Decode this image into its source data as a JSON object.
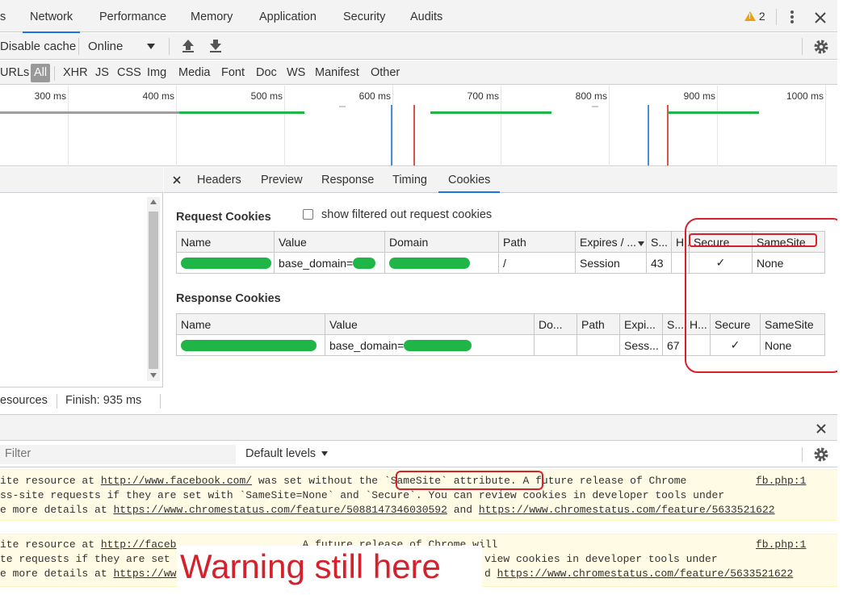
{
  "tabs": {
    "items": [
      "s",
      "Network",
      "Performance",
      "Memory",
      "Application",
      "Security",
      "Audits"
    ],
    "active": "Network",
    "warning_count": "2"
  },
  "toolbar": {
    "disable_cache": "Disable cache",
    "throttle": "Online"
  },
  "filters": {
    "urls": "URLs",
    "items": [
      "All",
      "XHR",
      "JS",
      "CSS",
      "Img",
      "Media",
      "Font",
      "Doc",
      "WS",
      "Manifest",
      "Other"
    ]
  },
  "timeline": {
    "ticks": [
      "300 ms",
      "400 ms",
      "500 ms",
      "600 ms",
      "700 ms",
      "800 ms",
      "900 ms",
      "1000 ms"
    ],
    "colors": {
      "green": "#1fb547",
      "grey": "#9e9e9e",
      "blue": "#4c8ed9",
      "red": "#d9534f"
    }
  },
  "left_panel": {
    "status_resources": "esources",
    "status_finish": "Finish: 935 ms"
  },
  "detail_tabs": {
    "items": [
      "Headers",
      "Preview",
      "Response",
      "Timing",
      "Cookies"
    ],
    "active": "Cookies"
  },
  "request_cookies": {
    "title": "Request Cookies",
    "filter_label": "show filtered out request cookies",
    "headers": [
      "Name",
      "Value",
      "Domain",
      "Path",
      "Expires / ...",
      "S...",
      "H...",
      "Secure",
      "SameSite"
    ],
    "row": {
      "value": "base_domain=",
      "path": "/",
      "expires": "Session",
      "size": "43",
      "secure": "✓",
      "samesite": "None"
    }
  },
  "response_cookies": {
    "title": "Response Cookies",
    "headers": [
      "Name",
      "Value",
      "Do...",
      "Path",
      "Expi...",
      "S...",
      "H...",
      "Secure",
      "SameSite"
    ],
    "row": {
      "value": "base_domain=",
      "expires": "Sess...",
      "size": "67",
      "secure": "✓",
      "samesite": "None"
    }
  },
  "console": {
    "filter_placeholder": "Filter",
    "levels": "Default levels",
    "warning1": {
      "l1a": "ite resource at ",
      "l1link": "http://www.facebook.com/",
      "l1b": " was set without the ",
      "l1c": "`SameSite` attribute.",
      "l1d": " A future release of Chrome",
      "l2": "ss-site requests if they are set with `SameSite=None` and `Secure`. You can review cookies in developer tools under",
      "l3a": "e more details at ",
      "l3link1": "https://www.chromestatus.com/feature/5088147346030592",
      "l3b": " and ",
      "l3link2": "https://www.chromestatus.com/feature/5633521622",
      "source": "fb.php:1"
    },
    "warning2": {
      "l1a": "ite resource at ",
      "l1link": "http://faceb",
      "l1b": "                    A future release of Chrome will",
      "l2a": "te requests if they are set",
      "l2b": "view cookies in developer tools under",
      "l3a": "e more details at ",
      "l3link1": "https://ww",
      "l3b": "d ",
      "l3link2": "https://www.chromestatus.com/feature/5633521622",
      "source": "fb.php:1"
    }
  },
  "annotation": {
    "text": "Warning still here",
    "color": "#d4212b"
  }
}
